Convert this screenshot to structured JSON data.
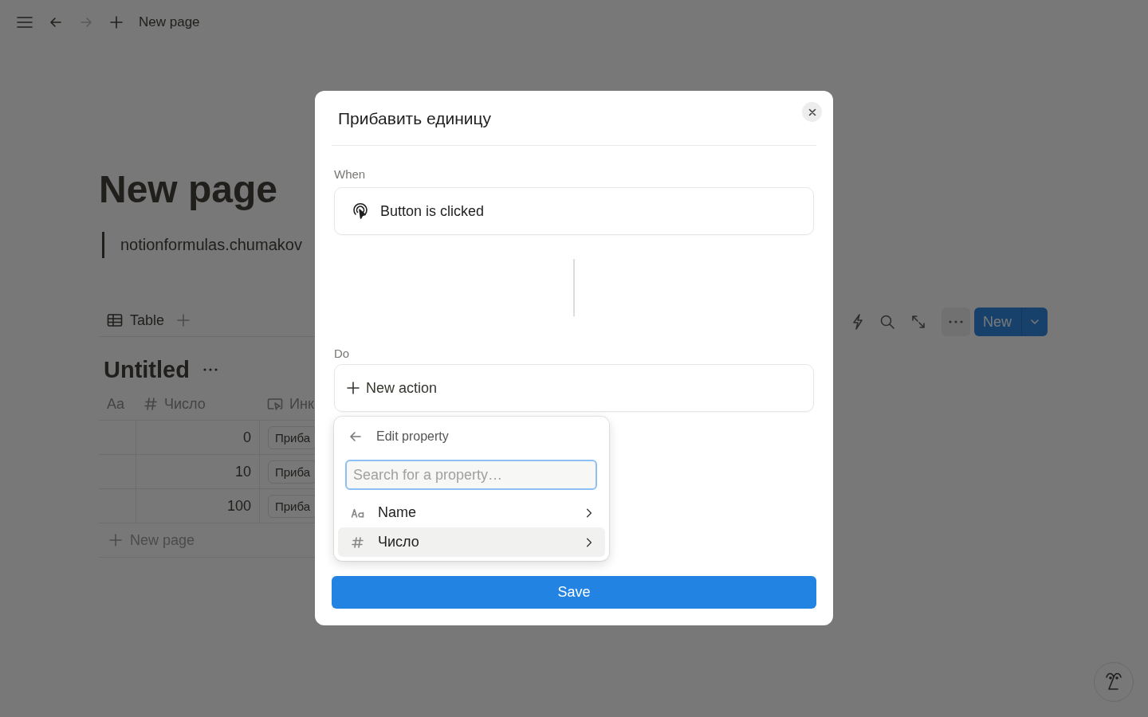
{
  "topbar": {
    "title": "New page"
  },
  "page": {
    "title": "New page",
    "quote": "notionformulas.chumakov",
    "views": [
      {
        "label": "Table"
      }
    ],
    "new_button": "New",
    "database_title": "Untitled",
    "columns": [
      {
        "kind": "title",
        "label": "Aa"
      },
      {
        "kind": "number",
        "label": "Число"
      },
      {
        "kind": "button",
        "label": "Инк"
      }
    ],
    "rows": [
      {
        "number": "0",
        "button": "Приба"
      },
      {
        "number": "10",
        "button": "Приба"
      },
      {
        "number": "100",
        "button": "Приба"
      }
    ],
    "add_row": "New page"
  },
  "modal": {
    "title": "Прибавить единицу",
    "when_label": "When",
    "trigger": "Button is clicked",
    "do_label": "Do",
    "new_action": "New action",
    "save": "Save",
    "popup": {
      "title": "Edit property",
      "search_placeholder": "Search for a property…",
      "items": [
        {
          "kind": "title",
          "label": "Name",
          "selected": false
        },
        {
          "kind": "number",
          "label": "Число",
          "selected": true
        }
      ]
    }
  }
}
